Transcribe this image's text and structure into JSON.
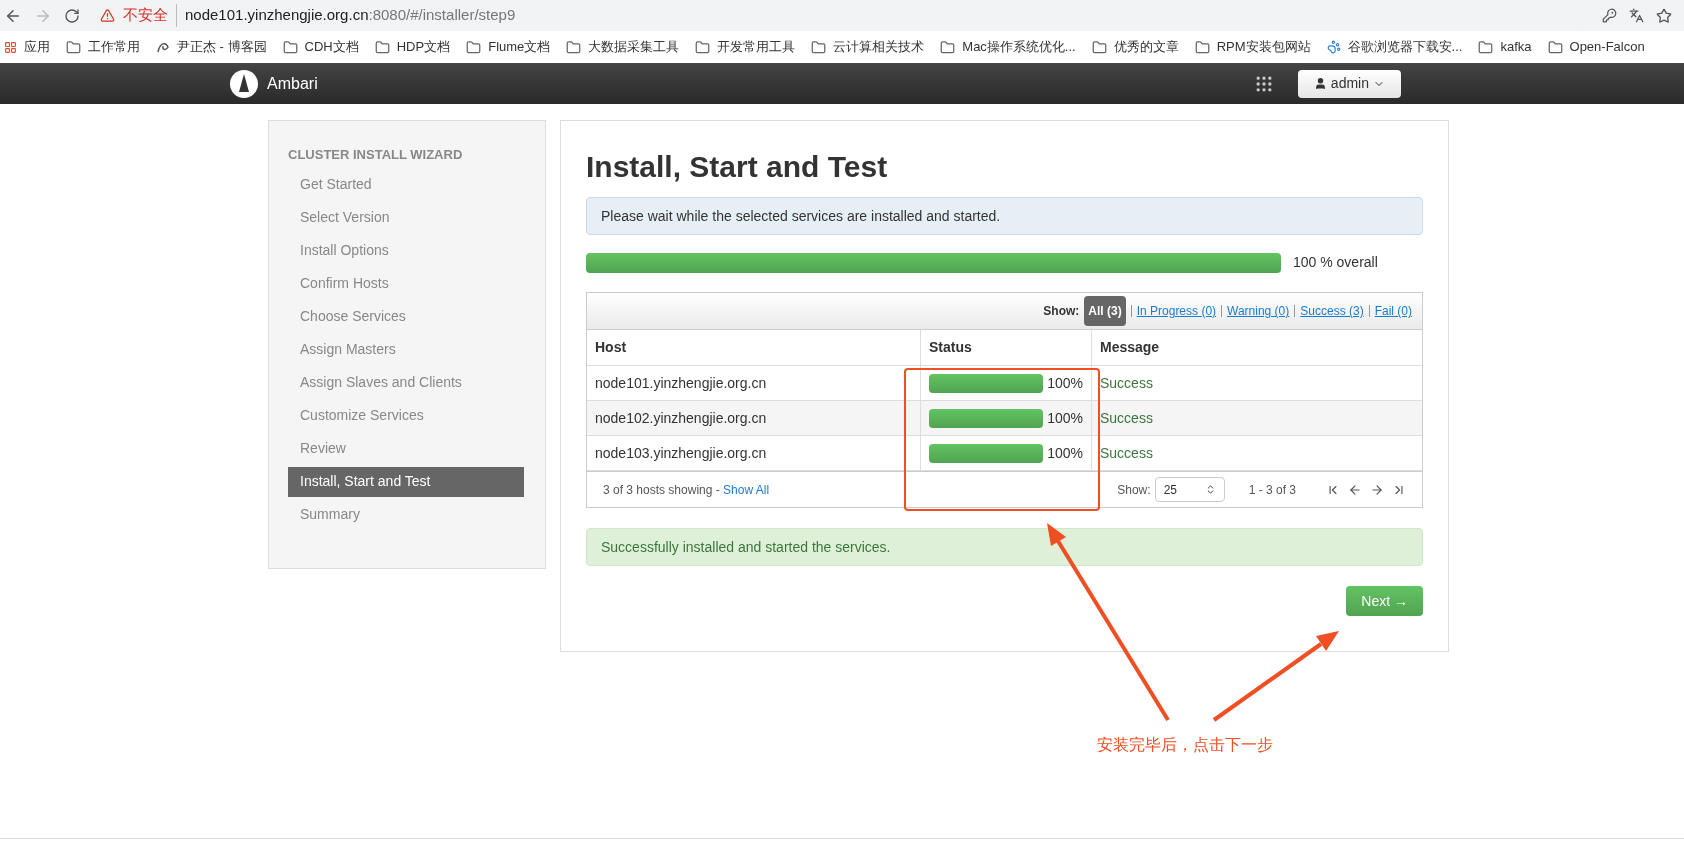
{
  "browser": {
    "security_label": "不安全",
    "url_host": "node101.yinzhengjie.org.cn",
    "url_rest": ":8080/#/installer/step9",
    "bookmarks": [
      {
        "kind": "apps",
        "label": "应用"
      },
      {
        "kind": "folder",
        "label": "工作常用"
      },
      {
        "kind": "site",
        "label": "尹正杰 - 博客园"
      },
      {
        "kind": "folder",
        "label": "CDH文档"
      },
      {
        "kind": "folder",
        "label": "HDP文档"
      },
      {
        "kind": "folder",
        "label": "Flume文档"
      },
      {
        "kind": "folder",
        "label": "大数据采集工具"
      },
      {
        "kind": "folder",
        "label": "开发常用工具"
      },
      {
        "kind": "folder",
        "label": "云计算相关技术"
      },
      {
        "kind": "folder",
        "label": "Mac操作系统优化..."
      },
      {
        "kind": "folder",
        "label": "优秀的文章"
      },
      {
        "kind": "folder",
        "label": "RPM安装包网站"
      },
      {
        "kind": "paw",
        "label": "谷歌浏览器下载安..."
      },
      {
        "kind": "folder",
        "label": "kafka"
      },
      {
        "kind": "folder",
        "label": "Open-Falcon"
      }
    ]
  },
  "navbar": {
    "brand": "Ambari",
    "user": "admin"
  },
  "sidebar": {
    "heading": "CLUSTER INSTALL WIZARD",
    "items": [
      {
        "label": "Get Started",
        "selected": false
      },
      {
        "label": "Select Version",
        "selected": false
      },
      {
        "label": "Install Options",
        "selected": false
      },
      {
        "label": "Confirm Hosts",
        "selected": false
      },
      {
        "label": "Choose Services",
        "selected": false
      },
      {
        "label": "Assign Masters",
        "selected": false
      },
      {
        "label": "Assign Slaves and Clients",
        "selected": false
      },
      {
        "label": "Customize Services",
        "selected": false
      },
      {
        "label": "Review",
        "selected": false
      },
      {
        "label": "Install, Start and Test",
        "selected": true
      },
      {
        "label": "Summary",
        "selected": false
      }
    ]
  },
  "main": {
    "title": "Install, Start and Test",
    "info": "Please wait while the selected services are installed and started.",
    "overall": {
      "level": 1,
      "reading": "100 % overall"
    },
    "filter_label": "Show:",
    "filters": [
      {
        "label": "All (3)",
        "selected": true
      },
      {
        "label": "In Progress (0)",
        "selected": false
      },
      {
        "label": "Warning (0)",
        "selected": false
      },
      {
        "label": "Success (3)",
        "selected": false
      },
      {
        "label": "Fail (0)",
        "selected": false
      }
    ],
    "table": {
      "columns": [
        "Host",
        "Status",
        "Message"
      ],
      "rows": [
        {
          "host": "node101.yinzhengjie.org.cn",
          "level": 1,
          "reading": "100%",
          "message": "Success"
        },
        {
          "host": "node102.yinzhengjie.org.cn",
          "level": 1,
          "reading": "100%",
          "message": "Success"
        },
        {
          "host": "node103.yinzhengjie.org.cn",
          "level": 1,
          "reading": "100%",
          "message": "Success"
        }
      ],
      "footer": {
        "showing": "3 of 3 hosts showing - ",
        "show_all": "Show All",
        "page_size_label": "Show:",
        "page_size": "25",
        "range": "1 - 3 of 3"
      }
    },
    "success": "Successfully installed and started the services.",
    "next": "Next →"
  },
  "annotation": "安装完毕后，点击下一步"
}
